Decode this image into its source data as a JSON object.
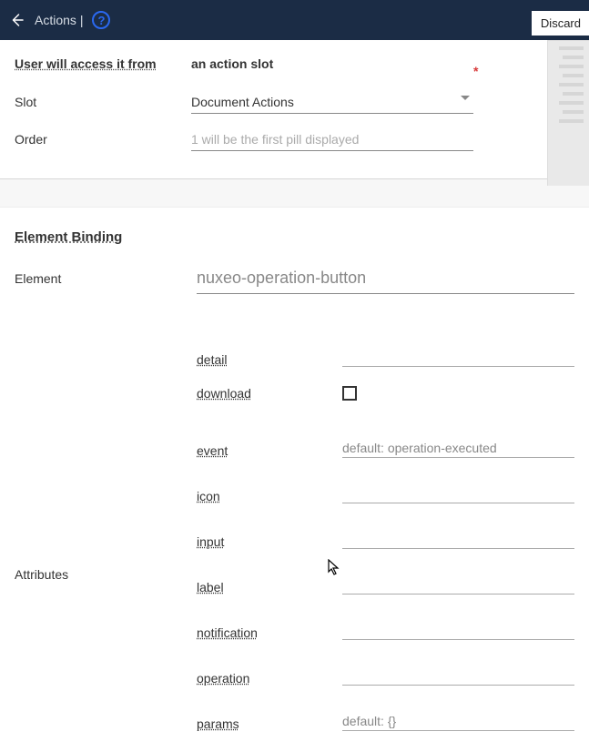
{
  "header": {
    "title": "Actions",
    "separator": "|",
    "discard": "Discard"
  },
  "section1": {
    "title": "User will access it from",
    "subtitle": "an action slot",
    "slot_label": "Slot",
    "slot_value": "Document Actions",
    "order_label": "Order",
    "order_placeholder": "1 will be the first pill displayed"
  },
  "section2": {
    "title": "Element Binding",
    "element_label": "Element",
    "element_value": "nuxeo-operation-button",
    "attributes_label": "Attributes",
    "attributes": [
      {
        "name": "detail",
        "type": "text",
        "placeholder": ""
      },
      {
        "name": "download",
        "type": "checkbox"
      },
      {
        "name": "event",
        "type": "text",
        "placeholder": "default: operation-executed"
      },
      {
        "name": "icon",
        "type": "text",
        "placeholder": ""
      },
      {
        "name": "input",
        "type": "text",
        "placeholder": ""
      },
      {
        "name": "label",
        "type": "text",
        "placeholder": ""
      },
      {
        "name": "notification",
        "type": "text",
        "placeholder": ""
      },
      {
        "name": "operation",
        "type": "text",
        "placeholder": ""
      },
      {
        "name": "params",
        "type": "text",
        "placeholder": "default: {}"
      }
    ]
  }
}
